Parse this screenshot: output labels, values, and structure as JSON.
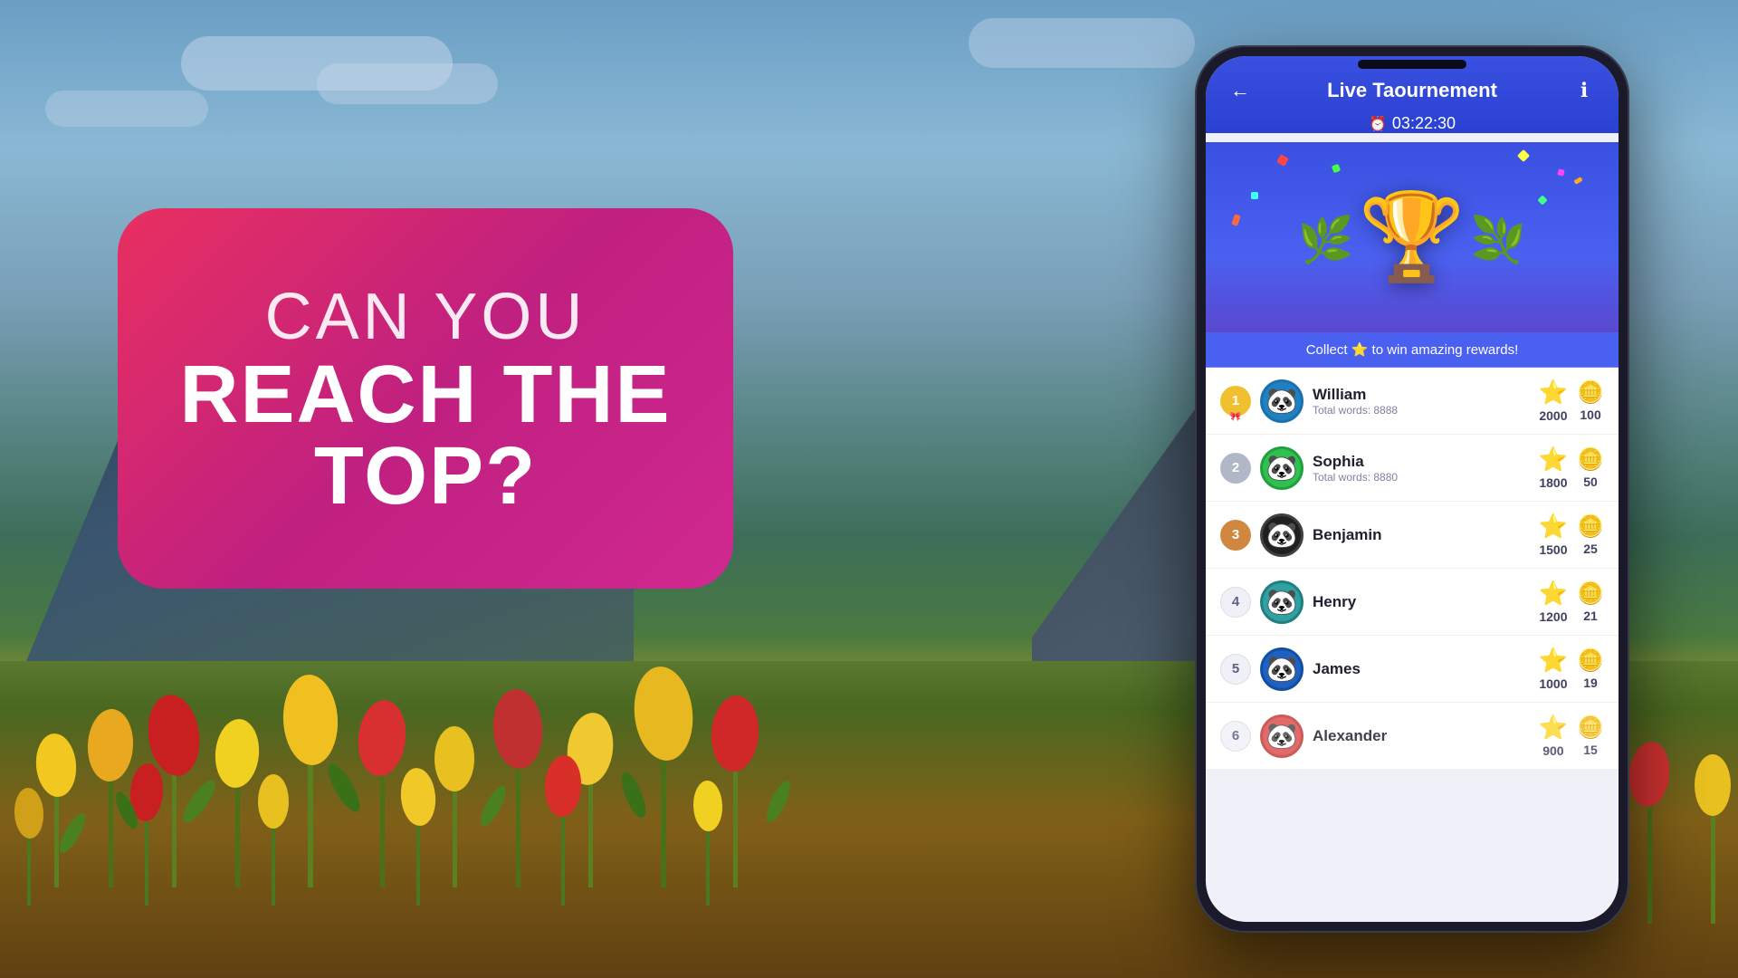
{
  "background": {
    "sky_color_top": "#7aa8c8",
    "sky_color_bottom": "#9abbd4"
  },
  "promo": {
    "line1": "CAN YOU",
    "line2": "REACH THE",
    "line3": "TOP?"
  },
  "app": {
    "title": "Live Taournement",
    "timer": "03:22:30",
    "timer_icon": "⏰",
    "collect_text": "Collect ⭐ to win amazing rewards!",
    "nav_back": "←",
    "nav_info": "ℹ"
  },
  "leaderboard": [
    {
      "rank": 1,
      "name": "William",
      "words": "Total words: 8888",
      "stars": 2000,
      "coins": 100,
      "avatar_color": "#2080c0",
      "ribbon": true
    },
    {
      "rank": 2,
      "name": "Sophia",
      "words": "Total words: 8880",
      "stars": 1800,
      "coins": 50,
      "avatar_color": "#30c050",
      "ribbon": false
    },
    {
      "rank": 3,
      "name": "Benjamin",
      "words": "",
      "stars": 1500,
      "coins": 25,
      "avatar_color": "#202020",
      "ribbon": false
    },
    {
      "rank": 4,
      "name": "Henry",
      "words": "",
      "stars": 1200,
      "coins": 21,
      "avatar_color": "#30a0a0",
      "ribbon": false
    },
    {
      "rank": 5,
      "name": "James",
      "words": "",
      "stars": 1000,
      "coins": 19,
      "avatar_color": "#2060c0",
      "ribbon": false
    },
    {
      "rank": 6,
      "name": "Alexander",
      "words": "",
      "stars": 900,
      "coins": 15,
      "avatar_color": "#e05050",
      "ribbon": false
    }
  ]
}
